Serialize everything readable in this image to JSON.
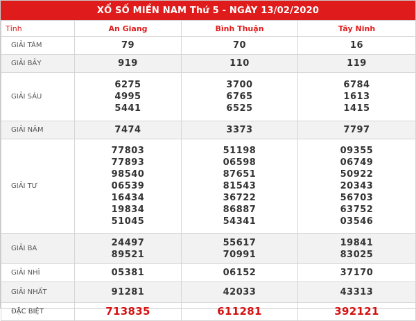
{
  "title": "XỔ SỐ MIỀN NAM Thứ 5 - NGÀY 13/02/2020",
  "columns": [
    "Tỉnh",
    "An Giang",
    "Bình Thuận",
    "Tây Ninh"
  ],
  "prizes": [
    {
      "label": "GIẢI TÁM",
      "values": [
        [
          "79"
        ],
        [
          "70"
        ],
        [
          "16"
        ]
      ]
    },
    {
      "label": "GIẢI BẢY",
      "values": [
        [
          "919"
        ],
        [
          "110"
        ],
        [
          "119"
        ]
      ]
    },
    {
      "label": "GIẢI SÁU",
      "values": [
        [
          "6275",
          "4995",
          "5441"
        ],
        [
          "3700",
          "6765",
          "6525"
        ],
        [
          "6784",
          "1613",
          "1415"
        ]
      ]
    },
    {
      "label": "GIẢI NĂM",
      "values": [
        [
          "7474"
        ],
        [
          "3373"
        ],
        [
          "7797"
        ]
      ]
    },
    {
      "label": "GIẢI TƯ",
      "values": [
        [
          "77803",
          "77893",
          "98540",
          "06539",
          "16434",
          "19834",
          "51045"
        ],
        [
          "51198",
          "06598",
          "87651",
          "81543",
          "36722",
          "86887",
          "54341"
        ],
        [
          "09355",
          "06749",
          "50922",
          "20343",
          "56703",
          "63752",
          "03546"
        ]
      ]
    },
    {
      "label": "GIẢI BA",
      "values": [
        [
          "24497",
          "89521"
        ],
        [
          "55617",
          "70991"
        ],
        [
          "19841",
          "83025"
        ]
      ]
    },
    {
      "label": "GIẢI NHÌ",
      "values": [
        [
          "05381"
        ],
        [
          "06152"
        ],
        [
          "37170"
        ]
      ]
    },
    {
      "label": "GIẢI NHẤT",
      "values": [
        [
          "91281"
        ],
        [
          "42033"
        ],
        [
          "43313"
        ]
      ]
    },
    {
      "label": "ĐẶC BIỆT",
      "values": [
        [
          "713835"
        ],
        [
          "611281"
        ],
        [
          "392121"
        ]
      ]
    }
  ],
  "colors": {
    "header_bg": "#e01b1b",
    "accent": "#e01b1b",
    "special": "#d41010"
  }
}
